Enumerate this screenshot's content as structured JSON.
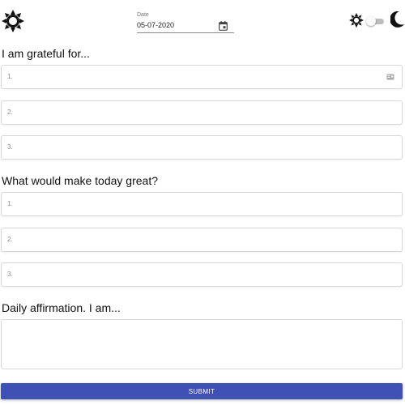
{
  "header": {
    "date_label": "Date",
    "date_value": "05-07-2020",
    "theme_toggle_on": false
  },
  "sections": {
    "grateful": {
      "title": "I am grateful for...",
      "fields": [
        {
          "placeholder": "1."
        },
        {
          "placeholder": "2."
        },
        {
          "placeholder": "3."
        }
      ]
    },
    "great": {
      "title": "What would make today great?",
      "fields": [
        {
          "placeholder": "1."
        },
        {
          "placeholder": "2."
        },
        {
          "placeholder": "3."
        }
      ]
    },
    "affirmation": {
      "title": "Daily affirmation. I am..."
    }
  },
  "submit_label": "SUBMIT",
  "colors": {
    "accent": "#3f51b5",
    "text": "#212121",
    "border": "#d7d7d7"
  },
  "icons": [
    "sun-icon",
    "calendar-icon",
    "contact-card-icon",
    "moon-icon"
  ]
}
